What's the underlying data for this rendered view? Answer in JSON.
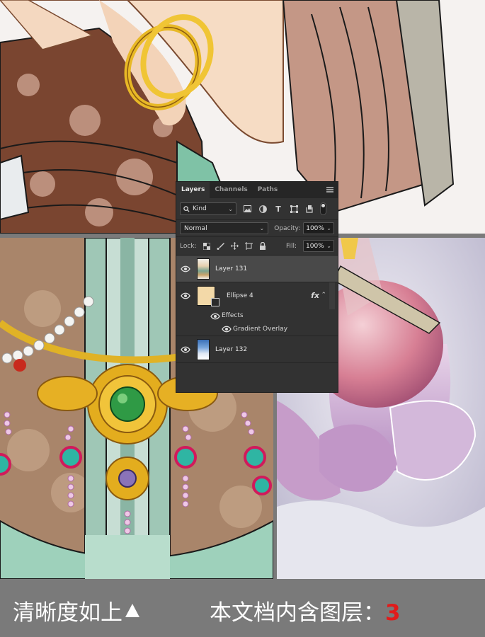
{
  "layers_panel": {
    "tabs": [
      "Layers",
      "Channels",
      "Paths"
    ],
    "filter": {
      "kind_label": "Kind"
    },
    "filter_icons": [
      "image-filter-icon",
      "adjustment-filter-icon",
      "type-filter-icon",
      "shape-filter-icon",
      "smart-object-filter-icon"
    ],
    "blend_mode": "Normal",
    "opacity_label": "Opacity:",
    "opacity_value": "100%",
    "lock_label": "Lock:",
    "fill_label": "Fill:",
    "fill_value": "100%",
    "layers": [
      {
        "name": "Layer 131",
        "selected": true
      },
      {
        "name": "Ellipse 4",
        "fx": "fx",
        "effects_label": "Effects",
        "effect": "Gradient Overlay"
      },
      {
        "name": "Layer 132"
      }
    ]
  },
  "banner": {
    "left_text": "清晰度如上",
    "right_text": "本文档内含图层：",
    "layer_count": "3"
  },
  "colors": {
    "panel_bg": "#323232",
    "selected_row": "#494949",
    "banner_bg": "#7a7a7a",
    "count_red": "#e11b1b"
  }
}
